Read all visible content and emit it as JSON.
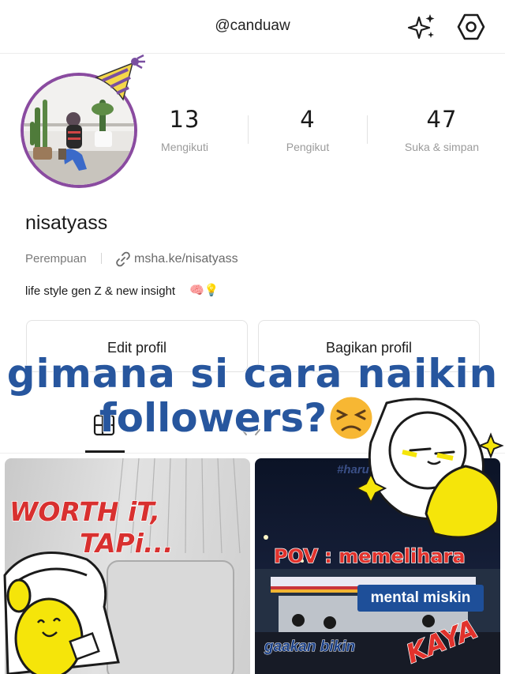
{
  "header": {
    "username": "@canduaw",
    "icons": [
      "sparkle-icon",
      "settings-hexagon-icon"
    ]
  },
  "profile": {
    "stats": [
      {
        "value": "13",
        "label": "Mengikuti"
      },
      {
        "value": "4",
        "label": "Pengikut"
      },
      {
        "value": "47",
        "label": "Suka & simpan"
      }
    ],
    "display_name": "nisatyass",
    "gender": "Perempuan",
    "link": "msha.ke/nisatyass",
    "bio": "life style gen Z & new insight",
    "bio_emojis": "🧠💡"
  },
  "buttons": {
    "edit": "Edit profil",
    "share": "Bagikan profil"
  },
  "overlay": {
    "line1": "gimana si cara naikin",
    "line2": "followers?"
  },
  "posts": [
    {
      "line1": "WORTH iT,",
      "line2": "TAPi..."
    },
    {
      "hashtag": "#haru",
      "pov": "POV :  memelihara",
      "banner": "mental miskin",
      "bottom": "gaakan bikin",
      "accent": "KAYA"
    }
  ],
  "colors": {
    "avatar_ring": "#8a4ba0",
    "overlay_text": "#27569e",
    "post_red": "#d8302f",
    "sticker_yellow": "#f5e50a"
  }
}
